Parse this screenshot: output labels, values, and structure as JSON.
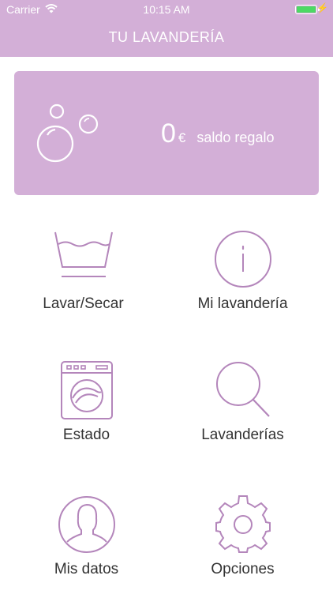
{
  "status_bar": {
    "carrier": "Carrier",
    "time": "10:15 AM"
  },
  "header": {
    "title": "TU LAVANDERÍA"
  },
  "balance_card": {
    "amount": "0",
    "currency": "€",
    "label": "saldo regalo",
    "icon": "bubbles-icon"
  },
  "menu": {
    "items": [
      {
        "label": "Lavar/Secar",
        "icon": "wash-basin-icon"
      },
      {
        "label": "Mi lavandería",
        "icon": "info-icon"
      },
      {
        "label": "Estado",
        "icon": "washing-machine-icon"
      },
      {
        "label": "Lavanderías",
        "icon": "search-icon"
      },
      {
        "label": "Mis datos",
        "icon": "user-icon"
      },
      {
        "label": "Opciones",
        "icon": "gear-icon"
      }
    ]
  },
  "colors": {
    "accent": "#d3afd7",
    "icon_stroke": "#b486bb",
    "label_text": "#333333"
  }
}
